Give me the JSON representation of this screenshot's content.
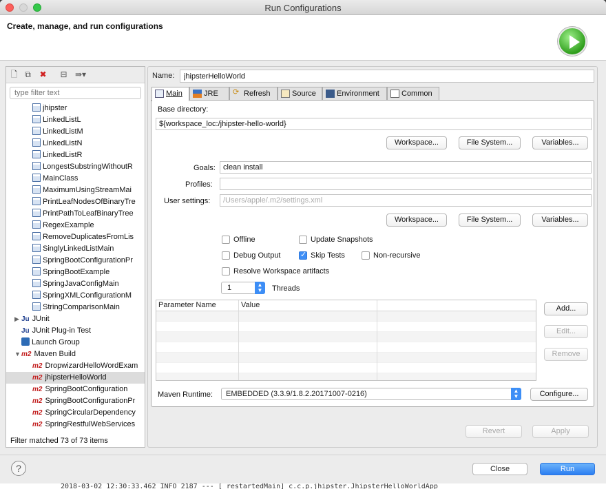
{
  "window": {
    "title": "Run Configurations"
  },
  "header": {
    "title": "Create, manage, and run configurations"
  },
  "left": {
    "filter_placeholder": "type filter text",
    "tree": [
      {
        "label": "jhipster",
        "icon": "java",
        "indent": 2
      },
      {
        "label": "LinkedListL",
        "icon": "java",
        "indent": 2
      },
      {
        "label": "LinkedListM",
        "icon": "java",
        "indent": 2
      },
      {
        "label": "LinkedListN",
        "icon": "java",
        "indent": 2
      },
      {
        "label": "LinkedListR",
        "icon": "java",
        "indent": 2
      },
      {
        "label": "LongestSubstringWithoutR",
        "icon": "java",
        "indent": 2
      },
      {
        "label": "MainClass",
        "icon": "java",
        "indent": 2
      },
      {
        "label": "MaximumUsingStreamMai",
        "icon": "java",
        "indent": 2
      },
      {
        "label": "PrintLeafNodesOfBinaryTre",
        "icon": "java",
        "indent": 2
      },
      {
        "label": "PrintPathToLeafBinaryTree",
        "icon": "java",
        "indent": 2
      },
      {
        "label": "RegexExample",
        "icon": "java",
        "indent": 2
      },
      {
        "label": "RemoveDuplicatesFromLis",
        "icon": "java",
        "indent": 2
      },
      {
        "label": "SinglyLinkedListMain",
        "icon": "java",
        "indent": 2
      },
      {
        "label": "SpringBootConfigurationPr",
        "icon": "java",
        "indent": 2
      },
      {
        "label": "SpringBootExample",
        "icon": "java",
        "indent": 2
      },
      {
        "label": "SpringJavaConfigMain",
        "icon": "java",
        "indent": 2
      },
      {
        "label": "SpringXMLConfigurationM",
        "icon": "java",
        "indent": 2
      },
      {
        "label": "StringComparisonMain",
        "icon": "java",
        "indent": 2
      },
      {
        "label": "JUnit",
        "icon": "junit",
        "indent": 0,
        "twisty": "▶"
      },
      {
        "label": "JUnit Plug-in Test",
        "icon": "junit",
        "indent": 1
      },
      {
        "label": "Launch Group",
        "icon": "launch",
        "indent": 1
      },
      {
        "label": "Maven Build",
        "icon": "m2",
        "indent": 0,
        "twisty": "▼"
      },
      {
        "label": "DropwizardHelloWordExam",
        "icon": "m2",
        "indent": 2
      },
      {
        "label": "jhipsterHelloWorld",
        "icon": "m2",
        "indent": 2,
        "selected": true
      },
      {
        "label": "SpringBootConfiguration",
        "icon": "m2",
        "indent": 2
      },
      {
        "label": "SpringBootConfigurationPr",
        "icon": "m2",
        "indent": 2
      },
      {
        "label": "SpringCircularDependency",
        "icon": "m2",
        "indent": 2
      },
      {
        "label": "SpringRestfulWebServices",
        "icon": "m2",
        "indent": 2
      }
    ],
    "filter_status": "Filter matched 73 of 73 items"
  },
  "name": {
    "label": "Name:",
    "value": "jhipsterHelloWorld"
  },
  "tabs": [
    {
      "label": "Main",
      "icon": "main-icon",
      "active": true
    },
    {
      "label": "JRE",
      "icon": "jre-icon"
    },
    {
      "label": "Refresh",
      "icon": "refresh-icon"
    },
    {
      "label": "Source",
      "icon": "source-icon"
    },
    {
      "label": "Environment",
      "icon": "environment-icon"
    },
    {
      "label": "Common",
      "icon": "common-icon"
    }
  ],
  "main": {
    "base_dir_label": "Base directory:",
    "base_dir_value": "${workspace_loc:/jhipster-hello-world}",
    "btn_workspace": "Workspace...",
    "btn_filesystem": "File System...",
    "btn_variables": "Variables...",
    "goals_label": "Goals:",
    "goals_value": "clean install",
    "profiles_label": "Profiles:",
    "profiles_value": "",
    "user_settings_label": "User settings:",
    "user_settings_placeholder": "/Users/apple/.m2/settings.xml",
    "options": {
      "offline": {
        "label": "Offline",
        "checked": false
      },
      "update_snapshots": {
        "label": "Update Snapshots",
        "checked": false
      },
      "debug_output": {
        "label": "Debug Output",
        "checked": false
      },
      "skip_tests": {
        "label": "Skip Tests",
        "checked": true
      },
      "non_recursive": {
        "label": "Non-recursive",
        "checked": false
      },
      "resolve_workspace": {
        "label": "Resolve Workspace artifacts",
        "checked": false
      }
    },
    "threads_value": "1",
    "threads_label": "Threads",
    "param_headers": [
      "Parameter Name",
      "Value"
    ],
    "btn_add": "Add...",
    "btn_edit": "Edit...",
    "btn_remove": "Remove",
    "runtime_label": "Maven Runtime:",
    "runtime_value": "EMBEDDED (3.3.9/1.8.2.20171007-0216)",
    "btn_configure": "Configure...",
    "btn_revert": "Revert",
    "btn_apply": "Apply"
  },
  "footer": {
    "close": "Close",
    "run": "Run",
    "help": "?"
  },
  "console_text": "2018-03-02 12:30:33.462  INFO 2187 ---  [ restartedMain] c.c.p.jhipster.JhipsterHelloWorldApp"
}
